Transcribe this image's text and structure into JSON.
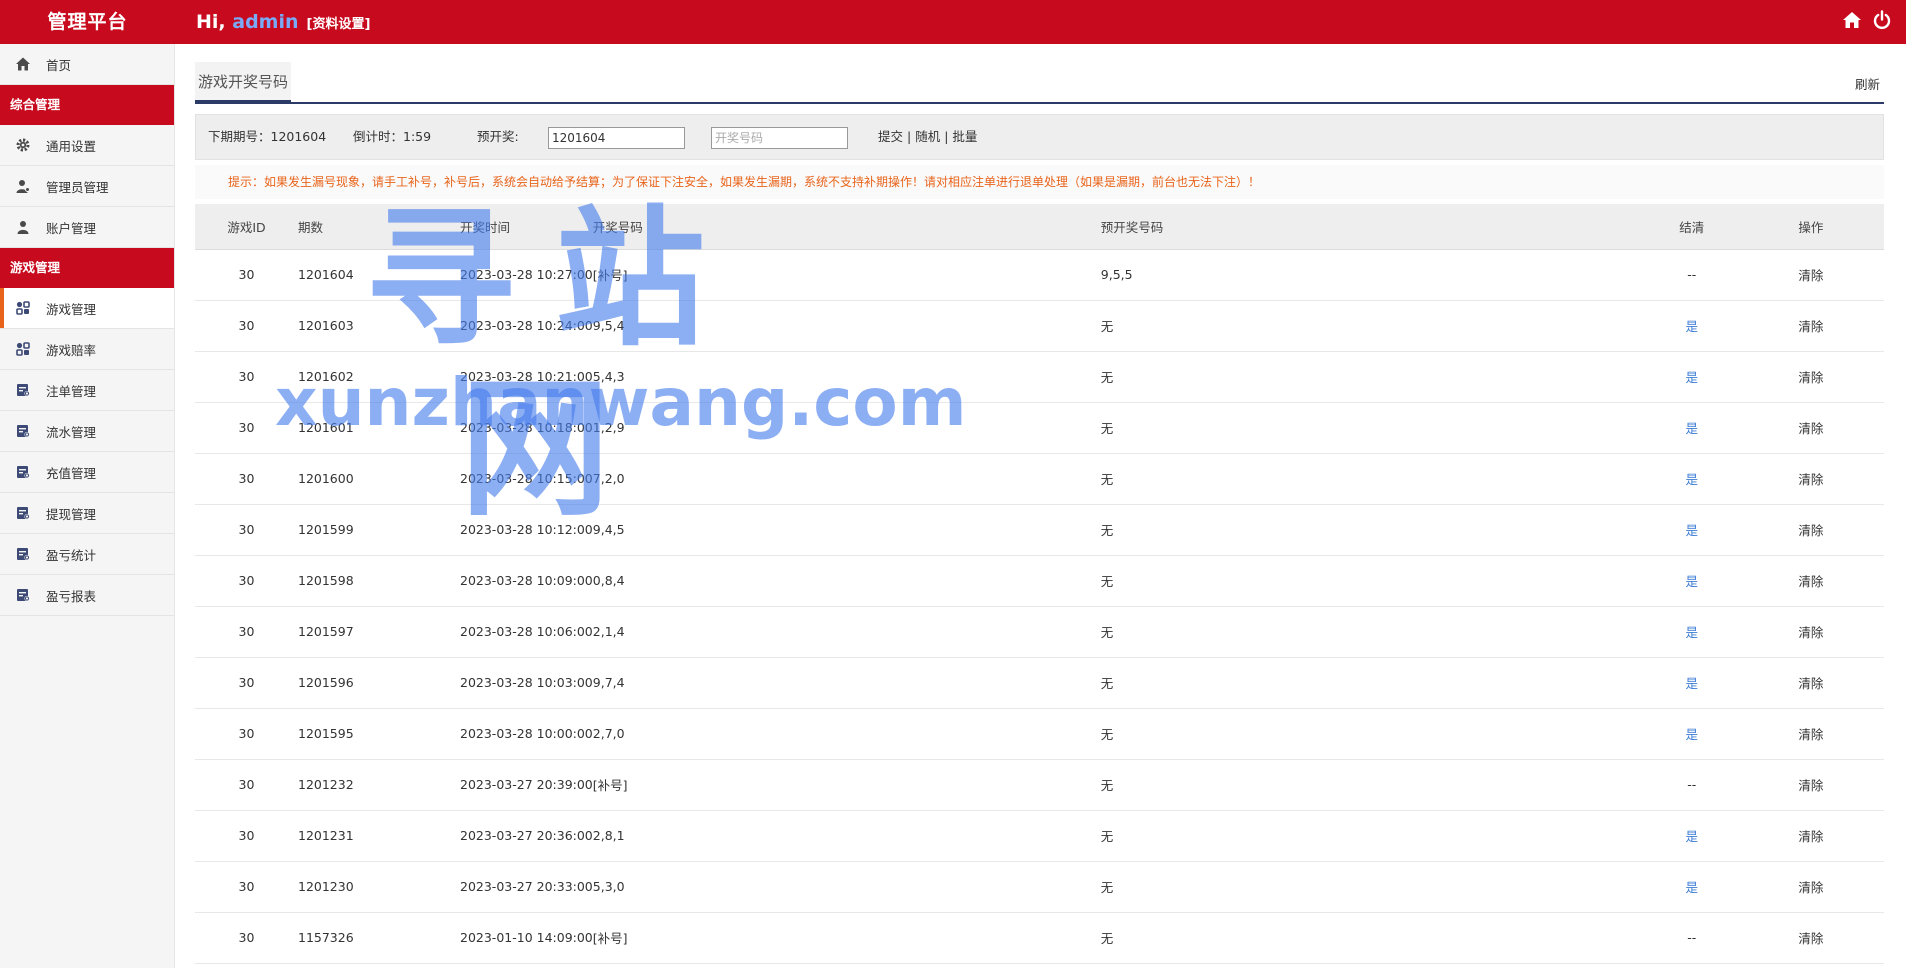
{
  "brand": "管理平台",
  "header": {
    "hi": "Hi, ",
    "user": "admin",
    "profile": "[资料设置]",
    "home_icon": "home-icon",
    "power_icon": "power-icon"
  },
  "sidebar": {
    "home": "首页",
    "group1": "综合管理",
    "general_settings": "通用设置",
    "admin_mgmt": "管理员管理",
    "account_mgmt": "账户管理",
    "group2": "游戏管理",
    "game_mgmt": "游戏管理",
    "game_odds": "游戏赔率",
    "bet_mgmt": "注单管理",
    "flow_mgmt": "流水管理",
    "recharge_mgmt": "充值管理",
    "withdraw_mgmt": "提现管理",
    "profit_stats": "盈亏统计",
    "profit_report": "盈亏报表"
  },
  "page": {
    "tab": "游戏开奖号码",
    "refresh": "刷新"
  },
  "toolbar": {
    "next_period": "下期期号：1201604",
    "countdown": "倒计时：1:59",
    "preset_label": "预开奖:",
    "period_value": "1201604",
    "number_placeholder": "开奖号码",
    "submit": "提交",
    "sep1": "|",
    "random": "随机",
    "sep2": "|",
    "batch": "批量"
  },
  "hint": "提示：如果发生漏号现象，请手工补号，补号后，系统会自动给予结算；为了保证下注安全，如果发生漏期，系统不支持补期操作！请对相应注单进行退单处理（如果是漏期，前台也无法下注）！",
  "table": {
    "headers": {
      "id": "游戏ID",
      "period": "期数",
      "time": "开奖时间",
      "number": "开奖号码",
      "preset": "预开奖号码",
      "settle": "结清",
      "op": "操作"
    },
    "rows": [
      {
        "id": "30",
        "period": "1201604",
        "time": "2023-03-28 10:27:00",
        "number": "[补号]",
        "preset": "9,5,5",
        "settle": "--",
        "op": "清除"
      },
      {
        "id": "30",
        "period": "1201603",
        "time": "2023-03-28 10:24:00",
        "number": "9,5,4",
        "preset": "无",
        "settle": "是",
        "op": "清除"
      },
      {
        "id": "30",
        "period": "1201602",
        "time": "2023-03-28 10:21:00",
        "number": "5,4,3",
        "preset": "无",
        "settle": "是",
        "op": "清除"
      },
      {
        "id": "30",
        "period": "1201601",
        "time": "2023-03-28 10:18:00",
        "number": "1,2,9",
        "preset": "无",
        "settle": "是",
        "op": "清除"
      },
      {
        "id": "30",
        "period": "1201600",
        "time": "2023-03-28 10:15:00",
        "number": "7,2,0",
        "preset": "无",
        "settle": "是",
        "op": "清除"
      },
      {
        "id": "30",
        "period": "1201599",
        "time": "2023-03-28 10:12:00",
        "number": "9,4,5",
        "preset": "无",
        "settle": "是",
        "op": "清除"
      },
      {
        "id": "30",
        "period": "1201598",
        "time": "2023-03-28 10:09:00",
        "number": "0,8,4",
        "preset": "无",
        "settle": "是",
        "op": "清除"
      },
      {
        "id": "30",
        "period": "1201597",
        "time": "2023-03-28 10:06:00",
        "number": "2,1,4",
        "preset": "无",
        "settle": "是",
        "op": "清除"
      },
      {
        "id": "30",
        "period": "1201596",
        "time": "2023-03-28 10:03:00",
        "number": "9,7,4",
        "preset": "无",
        "settle": "是",
        "op": "清除"
      },
      {
        "id": "30",
        "period": "1201595",
        "time": "2023-03-28 10:00:00",
        "number": "2,7,0",
        "preset": "无",
        "settle": "是",
        "op": "清除"
      },
      {
        "id": "30",
        "period": "1201232",
        "time": "2023-03-27 20:39:00",
        "number": "[补号]",
        "preset": "无",
        "settle": "--",
        "op": "清除"
      },
      {
        "id": "30",
        "period": "1201231",
        "time": "2023-03-27 20:36:00",
        "number": "2,8,1",
        "preset": "无",
        "settle": "是",
        "op": "清除"
      },
      {
        "id": "30",
        "period": "1201230",
        "time": "2023-03-27 20:33:00",
        "number": "5,3,0",
        "preset": "无",
        "settle": "是",
        "op": "清除"
      },
      {
        "id": "30",
        "period": "1157326",
        "time": "2023-01-10 14:09:00",
        "number": "[补号]",
        "preset": "无",
        "settle": "--",
        "op": "清除"
      }
    ]
  },
  "watermark": {
    "cn": "寻站网",
    "en": "xunzhanwang.com"
  },
  "colors": {
    "primary_red": "#c80a1e",
    "link_blue": "#3c7cd6",
    "hint_orange": "#e8641b",
    "nav_dark": "#2b3a67"
  }
}
